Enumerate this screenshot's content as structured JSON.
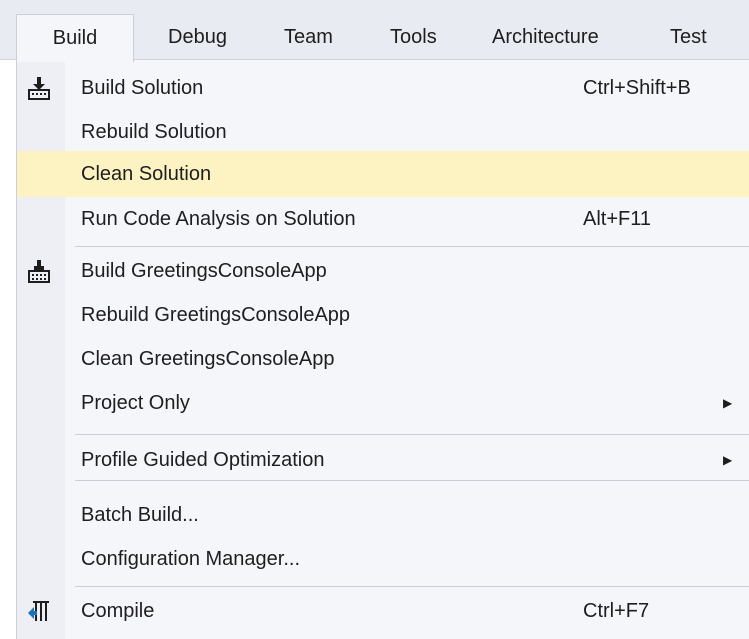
{
  "menubar": {
    "tabs": [
      "Build",
      "Debug",
      "Team",
      "Tools",
      "Architecture",
      "Test"
    ]
  },
  "menu": {
    "items": [
      {
        "label": "Build Solution",
        "shortcut": "Ctrl+Shift+B",
        "icon": "build-solution-icon"
      },
      {
        "label": "Rebuild Solution"
      },
      {
        "label": "Clean Solution",
        "highlighted": true
      },
      {
        "label": "Run Code Analysis on Solution",
        "shortcut": "Alt+F11"
      },
      {
        "label": "Build GreetingsConsoleApp",
        "icon": "build-project-icon"
      },
      {
        "label": "Rebuild GreetingsConsoleApp"
      },
      {
        "label": "Clean GreetingsConsoleApp"
      },
      {
        "label": "Project Only",
        "submenu": true
      },
      {
        "label": "Profile Guided Optimization",
        "submenu": true
      },
      {
        "label": "Batch Build..."
      },
      {
        "label": "Configuration Manager..."
      },
      {
        "label": "Compile",
        "shortcut": "Ctrl+F7",
        "icon": "compile-icon"
      }
    ]
  },
  "colors": {
    "menubar_bg": "#e9ebf2",
    "menu_bg": "#f5f6fa",
    "highlight": "#fcf2c2",
    "separator": "#cccedb"
  }
}
